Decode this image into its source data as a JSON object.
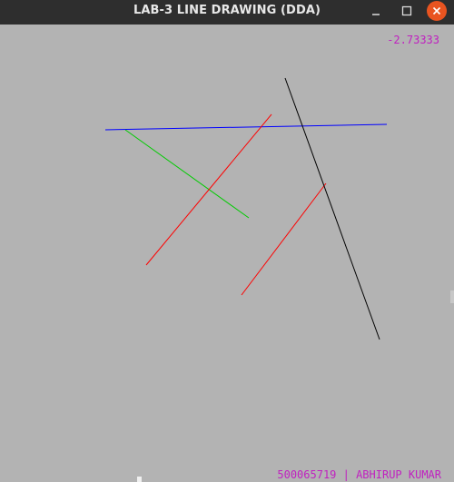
{
  "window": {
    "title": "LAB-3 LINE DRAWING (DDA)",
    "controls": {
      "minimize_icon": "minimize-icon",
      "maximize_icon": "maximize-icon",
      "close_icon": "close-icon",
      "close_color": "#e95420"
    }
  },
  "canvas": {
    "background": "#b3b3b3",
    "readout": "-2.73333",
    "footer": "500065719 | ABHIRUP KUMAR",
    "text_color": "#c020c0",
    "lines": [
      {
        "name": "blue-line",
        "color": "#0000ff"
      },
      {
        "name": "green-line",
        "color": "#00cc00"
      },
      {
        "name": "red-line-1",
        "color": "#ff0000"
      },
      {
        "name": "red-line-2",
        "color": "#ff0000"
      },
      {
        "name": "black-line",
        "color": "#000000"
      }
    ]
  }
}
